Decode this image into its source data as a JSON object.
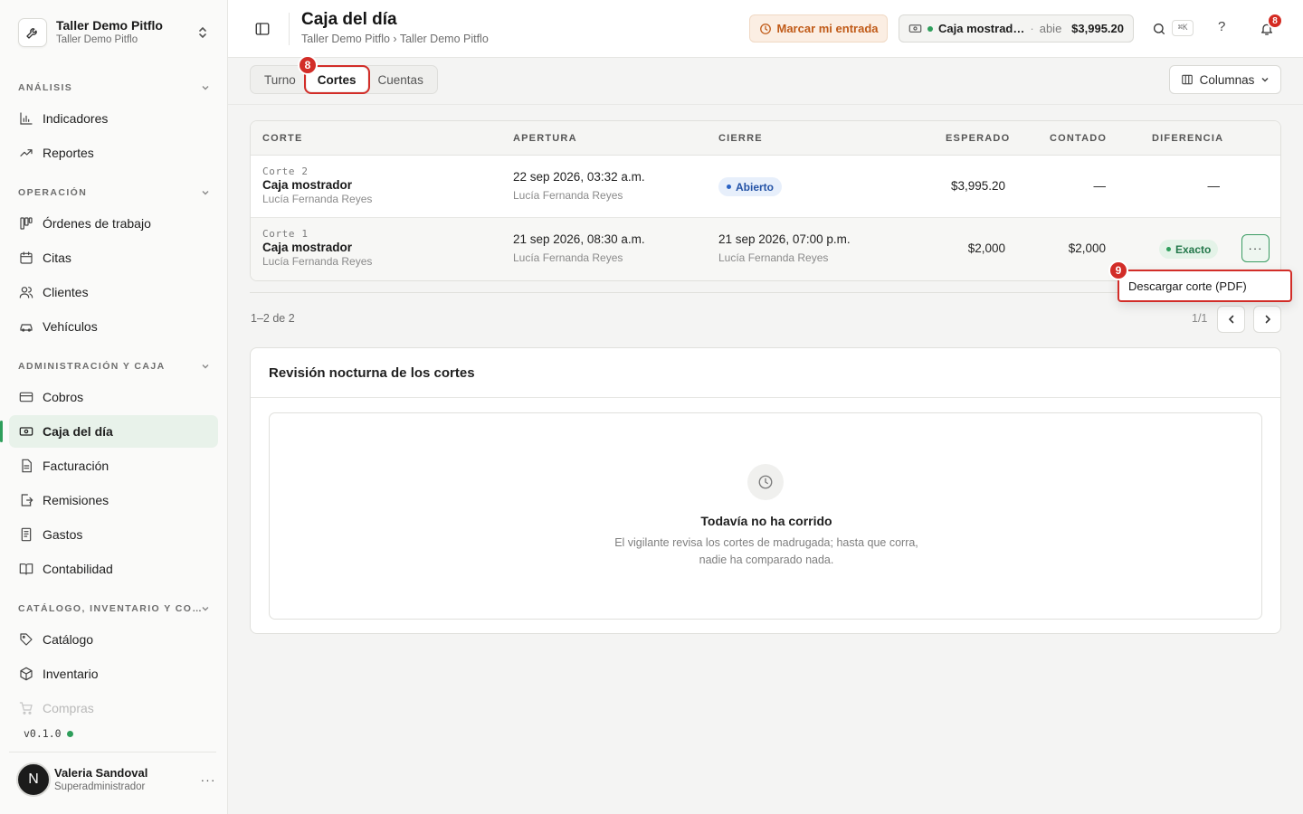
{
  "org": {
    "name": "Taller Demo Pitflo",
    "sub": "Taller Demo Pitflo"
  },
  "sidebar": {
    "sections": [
      {
        "label": "ANÁLISIS"
      },
      {
        "label": "OPERACIÓN"
      },
      {
        "label": "ADMINISTRACIÓN Y CAJA"
      },
      {
        "label": "CATÁLOGO, INVENTARIO Y CO…"
      }
    ],
    "items": [
      {
        "label": "Indicadores",
        "icon": "bar-chart-icon"
      },
      {
        "label": "Reportes",
        "icon": "trend-icon"
      },
      {
        "label": "Órdenes de trabajo",
        "icon": "kanban-icon"
      },
      {
        "label": "Citas",
        "icon": "calendar-icon"
      },
      {
        "label": "Clientes",
        "icon": "users-icon"
      },
      {
        "label": "Vehículos",
        "icon": "car-icon"
      },
      {
        "label": "Cobros",
        "icon": "card-icon"
      },
      {
        "label": "Caja del día",
        "icon": "cash-icon"
      },
      {
        "label": "Facturación",
        "icon": "invoice-icon"
      },
      {
        "label": "Remisiones",
        "icon": "file-export-icon"
      },
      {
        "label": "Gastos",
        "icon": "receipt-icon"
      },
      {
        "label": "Contabilidad",
        "icon": "book-icon"
      },
      {
        "label": "Catálogo",
        "icon": "tag-icon"
      },
      {
        "label": "Inventario",
        "icon": "box-icon"
      },
      {
        "label": "Compras",
        "icon": "cart-icon"
      }
    ],
    "version": "v0.1.0"
  },
  "user": {
    "initial": "N",
    "name": "Valeria Sandoval",
    "role": "Superadministrador",
    "more": "···"
  },
  "header": {
    "title": "Caja del día",
    "breadcrumb": "Taller Demo Pitflo › Taller Demo Pitflo",
    "clock_in": "Marcar mi entrada",
    "register_name": "Caja mostrad…",
    "register_sep": "·",
    "register_state": "abie",
    "register_amount": "$3,995.20",
    "shortcut": "⌘K",
    "help": "?",
    "notifications": "8"
  },
  "tabs": [
    {
      "label": "Turno"
    },
    {
      "label": "Cortes"
    },
    {
      "label": "Cuentas"
    }
  ],
  "markers": {
    "tab": "8",
    "menu": "9"
  },
  "columns_button": "Columnas",
  "table": {
    "headers": [
      "CORTE",
      "APERTURA",
      "CIERRE",
      "ESPERADO",
      "CONTADO",
      "DIFERENCIA"
    ],
    "rows": [
      {
        "corte_label": "Corte 2",
        "corte_name": "Caja mostrador",
        "corte_user": "Lucía Fernanda Reyes",
        "apertura_date": "22 sep 2026, 03:32 a.m.",
        "apertura_user": "Lucía Fernanda Reyes",
        "cierre_badge": "Abierto",
        "esperado": "$3,995.20",
        "contado": "—",
        "diferencia": "—"
      },
      {
        "corte_label": "Corte 1",
        "corte_name": "Caja mostrador",
        "corte_user": "Lucía Fernanda Reyes",
        "apertura_date": "21 sep 2026, 08:30 a.m.",
        "apertura_user": "Lucía Fernanda Reyes",
        "cierre_date": "21 sep 2026, 07:00 p.m.",
        "cierre_user": "Lucía Fernanda Reyes",
        "esperado": "$2,000",
        "contado": "$2,000",
        "diferencia_badge": "Exacto",
        "more": "···"
      }
    ]
  },
  "dropdown": {
    "item": "Descargar corte (PDF)"
  },
  "pagination": {
    "info": "1–2 de 2",
    "count": "1/1"
  },
  "review": {
    "title": "Revisión nocturna de los cortes",
    "empty_title": "Todavía no ha corrido",
    "empty_desc": "El vigilante revisa los cortes de madrugada; hasta que corra, nadie ha comparado nada."
  },
  "colors": {
    "accent": "#2e9e5b",
    "marker": "#d22d28",
    "warning": "#c05a17"
  }
}
